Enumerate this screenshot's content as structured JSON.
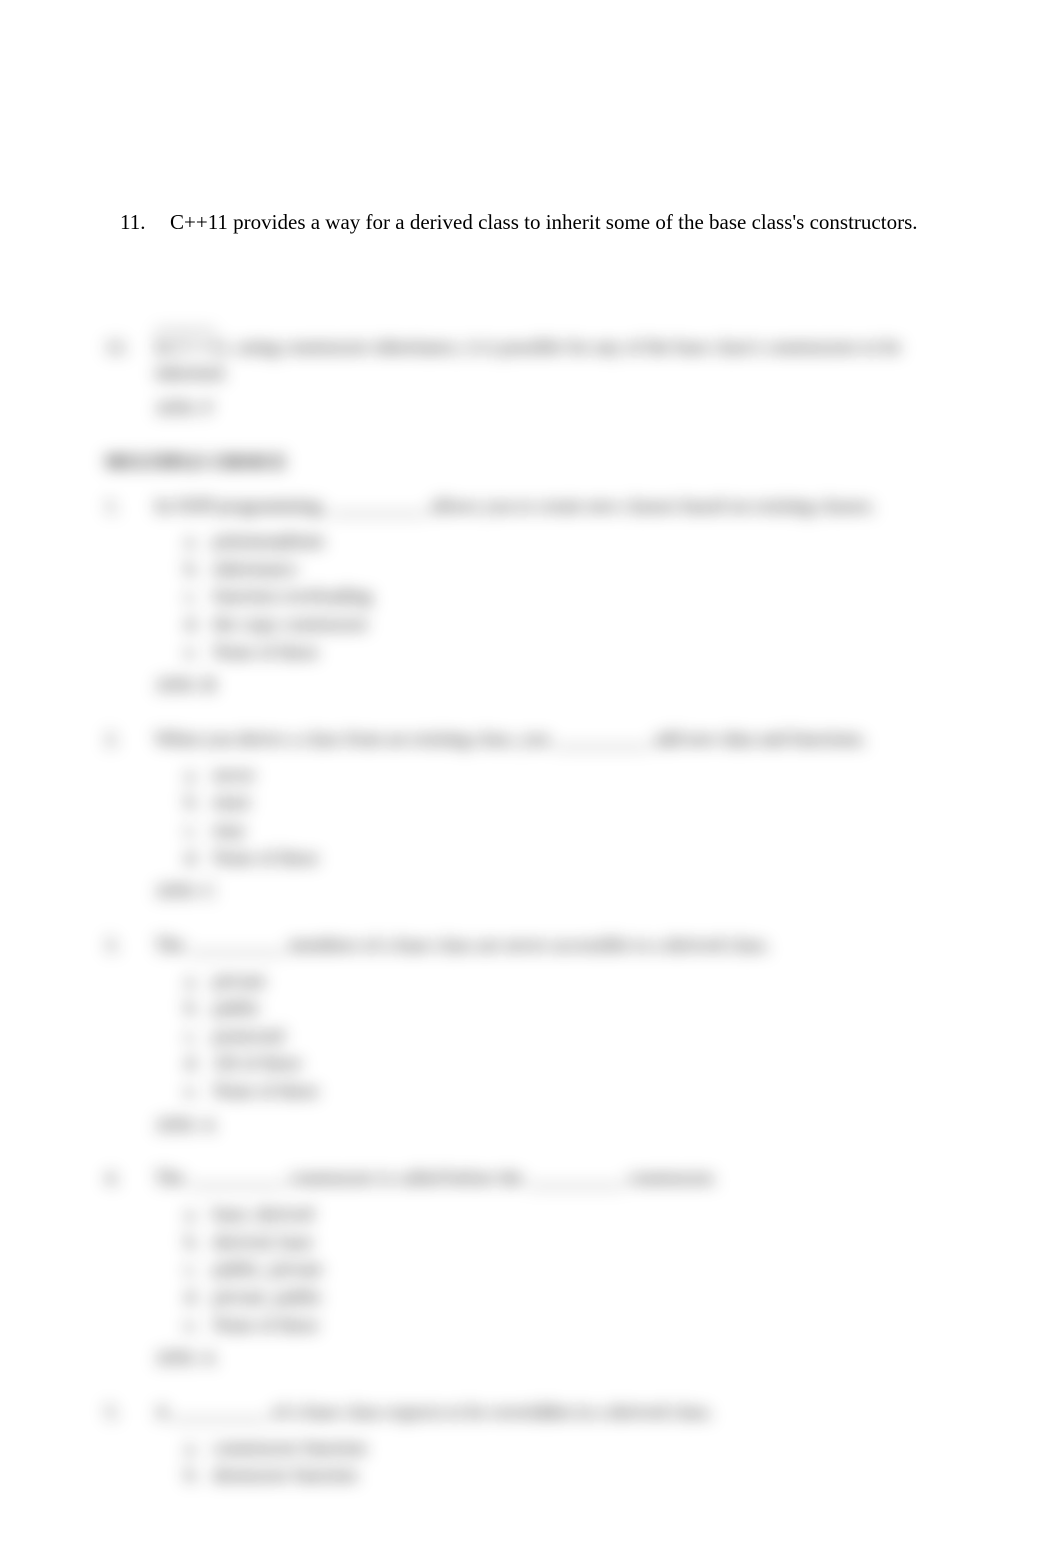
{
  "visible": {
    "q11": {
      "num": "11.",
      "text": "C++11 provides a way for a derived class to inherit some of the base class's constructors."
    }
  },
  "blurred": {
    "q12": {
      "num": "12.",
      "text": "In C++11, using constructor inheritance, it is possible for any of the base class's constructors to be inherited.",
      "ans": "ANS:  F"
    },
    "section": "MULTIPLE CHOICE",
    "mc1": {
      "num": "1.",
      "text": "In OOP programming, __________ allows you to create new classes based on existing classes.",
      "opts": [
        {
          "l": "a.",
          "t": "polymorphism"
        },
        {
          "l": "b.",
          "t": "inheritance"
        },
        {
          "l": "c.",
          "t": "function overloading"
        },
        {
          "l": "d.",
          "t": "the copy constructor"
        },
        {
          "l": "e.",
          "t": "None of these"
        }
      ],
      "ans": "ANS:  B"
    },
    "mc2": {
      "num": "2.",
      "text": "When you derive a class from an existing class, you __________ add new data and functions.",
      "opts": [
        {
          "l": "a.",
          "t": "never"
        },
        {
          "l": "b.",
          "t": "must"
        },
        {
          "l": "c.",
          "t": "may"
        },
        {
          "l": "d.",
          "t": "None of these"
        }
      ],
      "ans": "ANS:  C"
    },
    "mc3": {
      "num": "3.",
      "text": "The __________ members of a base class are never accessible to a derived class.",
      "opts": [
        {
          "l": "a.",
          "t": "private"
        },
        {
          "l": "b.",
          "t": "public"
        },
        {
          "l": "c.",
          "t": "protected"
        },
        {
          "l": "d.",
          "t": "All of these"
        },
        {
          "l": "e.",
          "t": "None of these"
        }
      ],
      "ans": "ANS:  A"
    },
    "mc4": {
      "num": "4.",
      "text": "The __________ constructor is called before the __________ constructor.",
      "opts": [
        {
          "l": "a.",
          "t": "base, derived"
        },
        {
          "l": "b.",
          "t": "derived, base"
        },
        {
          "l": "c.",
          "t": "public, private"
        },
        {
          "l": "d.",
          "t": "private, public"
        },
        {
          "l": "e.",
          "t": "None of these"
        }
      ],
      "ans": "ANS:  A"
    },
    "mc5": {
      "num": "5.",
      "text": "A __________ of a base class expects to be overridden in a derived class.",
      "opts": [
        {
          "l": "a.",
          "t": "constructor function"
        },
        {
          "l": "b.",
          "t": "destructor function"
        }
      ]
    }
  }
}
